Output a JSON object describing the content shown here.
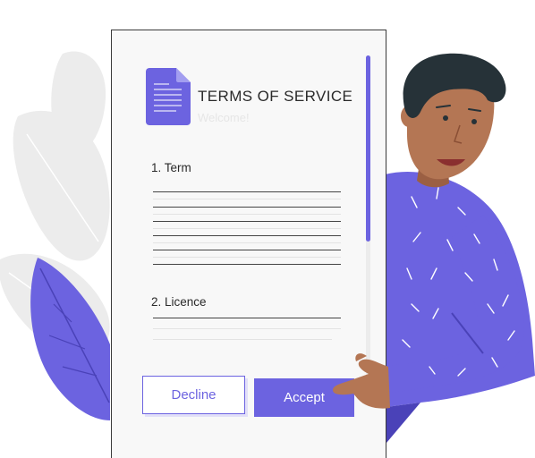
{
  "document": {
    "title": "TERMS OF SERVICE",
    "subtitle": "Welcome!",
    "sections": [
      {
        "heading": "1. Term"
      },
      {
        "heading": "2. Licence"
      }
    ]
  },
  "buttons": {
    "decline_label": "Decline",
    "accept_label": "Accept"
  },
  "scroll": {
    "position_fraction": 0.0,
    "visible_fraction": 0.56
  },
  "colors": {
    "accent": "#6c63e0",
    "skin": "#b47654",
    "hair": "#263238",
    "foliage_light": "#ebebeb",
    "foliage_accent": "#6c63e0"
  }
}
